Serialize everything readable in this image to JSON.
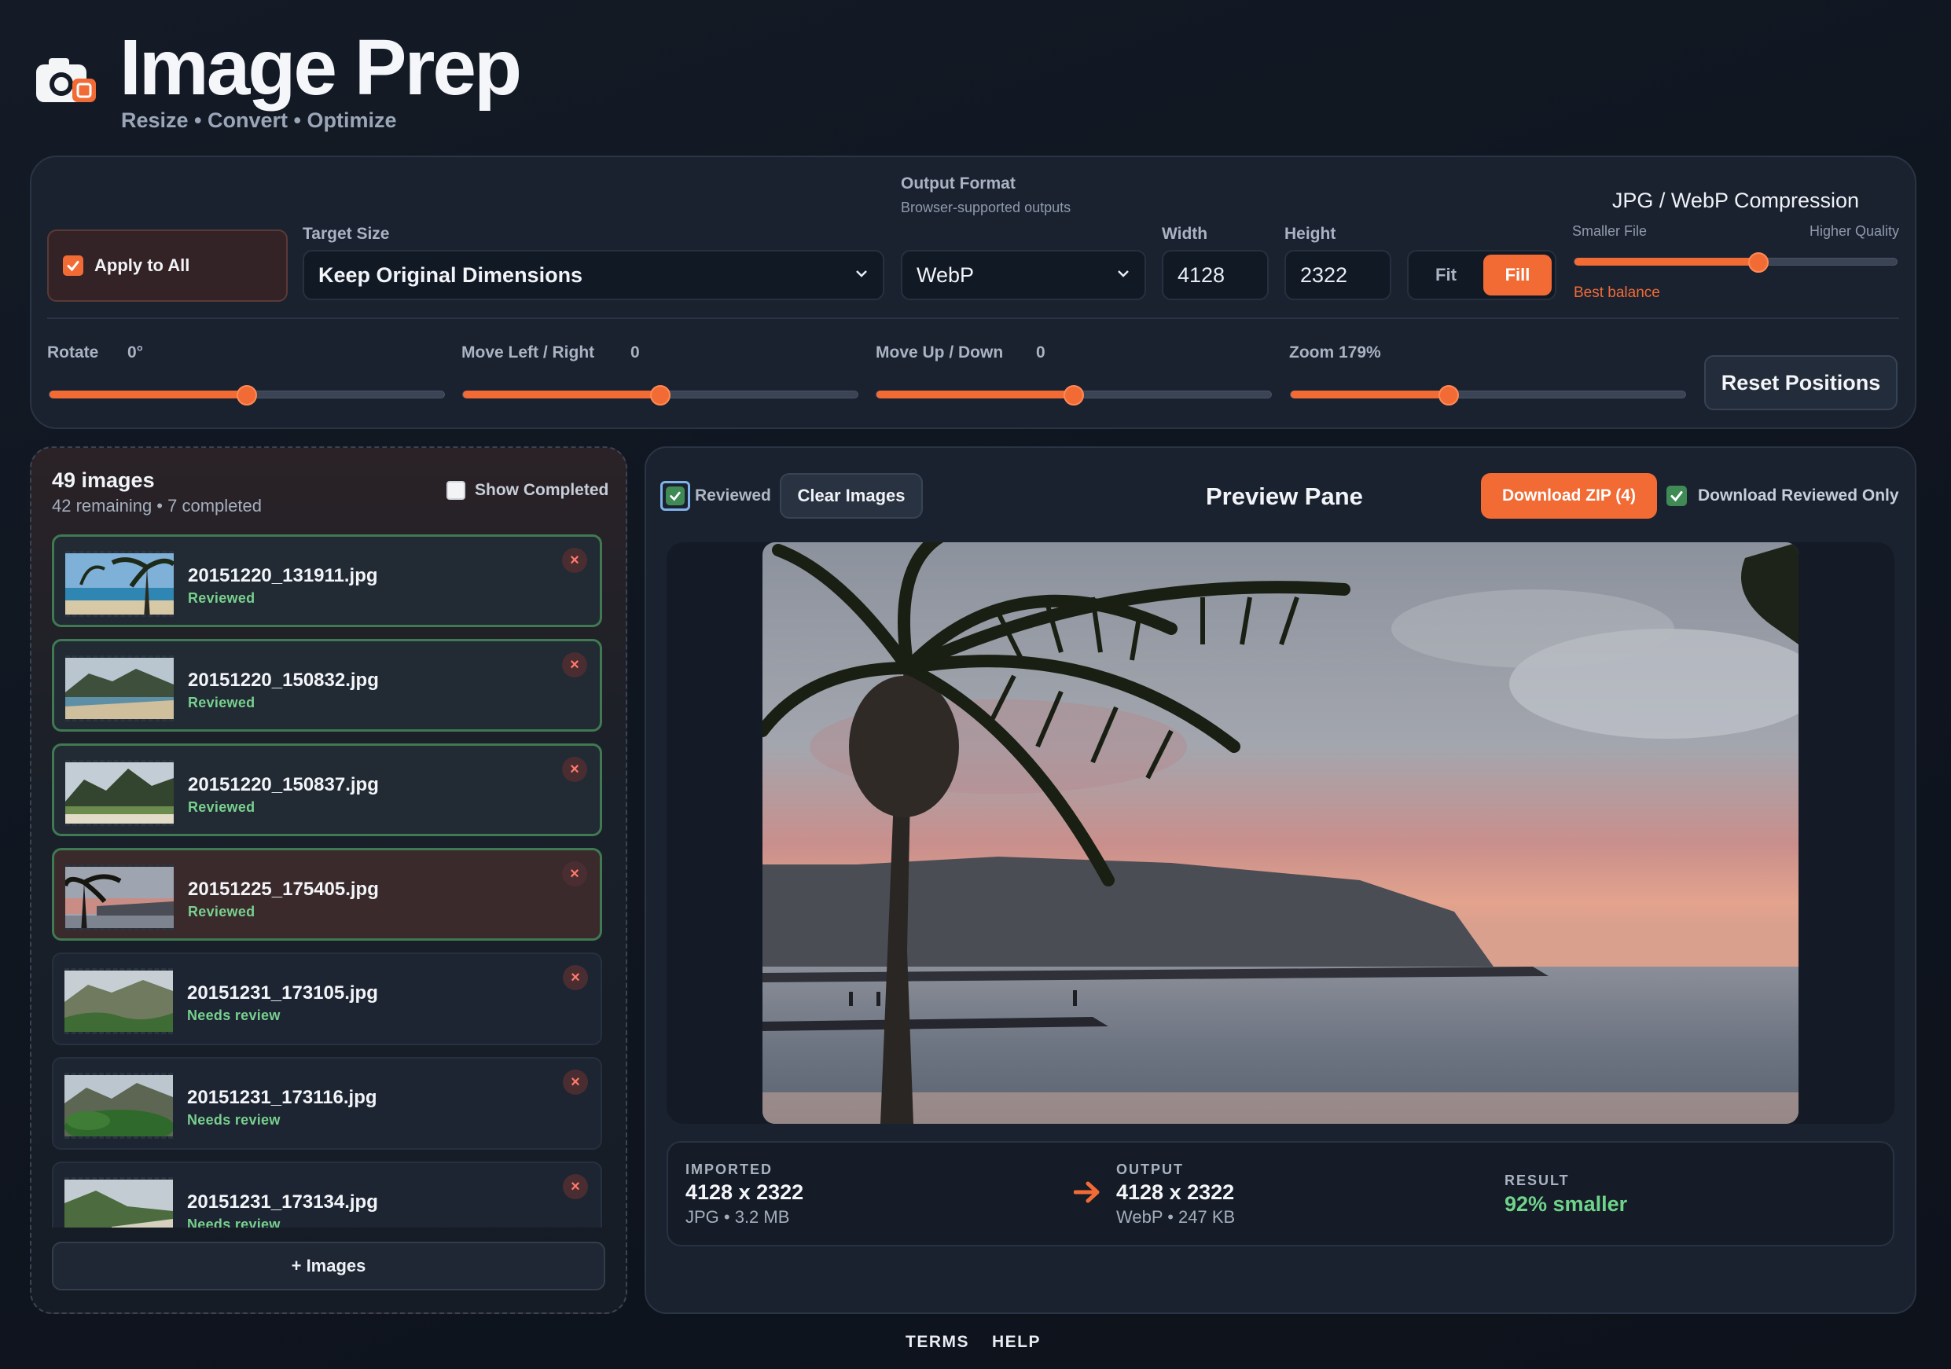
{
  "app": {
    "title": "Image Prep",
    "tagline": "Resize • Convert • Optimize",
    "logo_icon": "camera-icon",
    "accent_color": "#f26b35"
  },
  "controls": {
    "apply_all": {
      "label": "Apply to All",
      "checked": true
    },
    "target_size": {
      "label": "Target Size",
      "value": "Keep Original Dimensions"
    },
    "output_format": {
      "label": "Output Format",
      "hint": "Browser-supported outputs",
      "value": "WebP"
    },
    "width": {
      "label": "Width",
      "value": "4128"
    },
    "height": {
      "label": "Height",
      "value": "2322"
    },
    "fit_mode": {
      "options": [
        "Fit",
        "Fill"
      ],
      "selected": "Fill"
    },
    "compression": {
      "title": "JPG / WebP Compression",
      "min_label": "Smaller File",
      "max_label": "Higher Quality",
      "hint": "Best balance",
      "level": 0.57
    },
    "rotate": {
      "label": "Rotate",
      "value": "0°",
      "level": 0.5
    },
    "move_lr": {
      "label": "Move Left / Right",
      "value": "0",
      "level": 0.5
    },
    "move_ud": {
      "label": "Move Up / Down",
      "value": "0",
      "level": 0.5
    },
    "zoom": {
      "label": "Zoom 179%",
      "level": 0.4
    },
    "reset_label": "Reset Positions"
  },
  "list": {
    "count_title": "49 images",
    "count_sub": "42 remaining • 7 completed",
    "show_completed_label": "Show Completed",
    "show_completed": false,
    "items": [
      {
        "name": "20151220_131911.jpg",
        "status": "Reviewed",
        "state": "reviewed",
        "thumb": "beach"
      },
      {
        "name": "20151220_150832.jpg",
        "status": "Reviewed",
        "state": "reviewed",
        "thumb": "coast"
      },
      {
        "name": "20151220_150837.jpg",
        "status": "Reviewed",
        "state": "reviewed",
        "thumb": "mountain"
      },
      {
        "name": "20151225_175405.jpg",
        "status": "Reviewed",
        "state": "active",
        "thumb": "sunset"
      },
      {
        "name": "20151231_173105.jpg",
        "status": "Needs review",
        "state": "pending",
        "thumb": "hills"
      },
      {
        "name": "20151231_173116.jpg",
        "status": "Needs review",
        "state": "pending",
        "thumb": "shrub"
      },
      {
        "name": "20151231_173134.jpg",
        "status": "Needs review",
        "state": "pending",
        "thumb": "shore"
      }
    ],
    "remove_glyph": "×",
    "add_label": "+ Images"
  },
  "preview": {
    "reviewed_label": "Reviewed",
    "reviewed_checked": true,
    "clear_label": "Clear Images",
    "title": "Preview Pane",
    "zip_label": "Download ZIP (4)",
    "download_reviewed_label": "Download Reviewed Only",
    "download_reviewed_checked": true
  },
  "stats": {
    "imported_caption": "IMPORTED",
    "imported_dims": "4128 x 2322",
    "imported_meta": "JPG • 3.2 MB",
    "output_caption": "OUTPUT",
    "output_dims": "4128 x 2322",
    "output_meta": "WebP • 247 KB",
    "result_caption": "RESULT",
    "result_value": "92% smaller",
    "arrow_icon": "arrow-right-icon"
  },
  "footer": {
    "links": [
      "TERMS",
      "HELP"
    ]
  }
}
